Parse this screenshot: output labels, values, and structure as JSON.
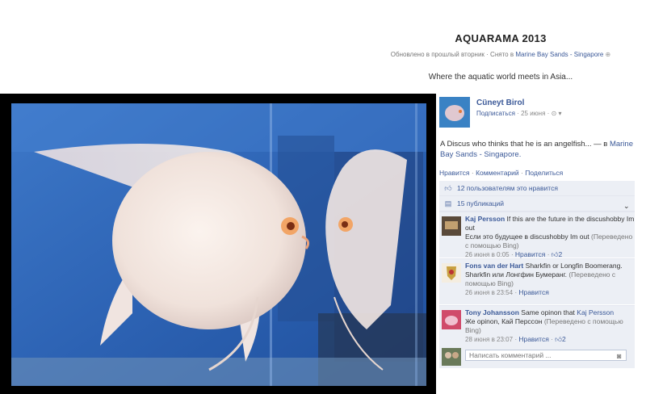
{
  "album": {
    "title": "AQUARAMA 2013",
    "updated": "Обновлено в прошлый вторник",
    "sep": "·",
    "taken_at_prefix": "Снято в",
    "location": "Marine Bay Sands - Singapore",
    "description": "Where the aquatic world meets in Asia..."
  },
  "owner": {
    "name": "Cüneyt Birol",
    "subscribe": "Подписаться",
    "date": "25 июня",
    "sep": "·"
  },
  "caption": {
    "text": "A Discus who thinks that he is an angelfish... — в",
    "location": "Marine Bay Sands - Singapore."
  },
  "actions": {
    "like": "Нравится",
    "comment": "Комментарий",
    "share": "Поделиться",
    "sep": "·"
  },
  "likes_text": "12 пользователям это нравится",
  "shares_text": "15 публикаций",
  "comments": [
    {
      "author": "Kaj Persson",
      "text": "If this are the future in the discushobby Im out",
      "translated": "Если это будущее в discushobby Im out",
      "translated_note": "(Переведено с помощью Bing)",
      "date": "26 июня в 0:05",
      "like": "Нравится",
      "likes": "2"
    },
    {
      "author": "Fons van der Hart",
      "text": "Sharkfin or Longfin Boomerang.",
      "translated": "Sharkfin или Лонгфин Бумеранг.",
      "translated_note": "(Переведено с помощью Bing)",
      "date": "26 июня в 23:54",
      "like": "Нравится",
      "likes": ""
    },
    {
      "author": "Tony Johansson",
      "text": "Same opinon that",
      "mention": "Kaj Persson",
      "translated": "Же opinon, Кай Перссон",
      "translated_note": "(Переведено с помощью Bing)",
      "date": "28 июня в 23:07",
      "like": "Нравится",
      "likes": "2"
    }
  ],
  "comment_input": {
    "placeholder": "Написать комментарий ..."
  },
  "colors": {
    "link": "#3b5998",
    "panel": "#eceff5",
    "photo_bg": "#000000"
  }
}
